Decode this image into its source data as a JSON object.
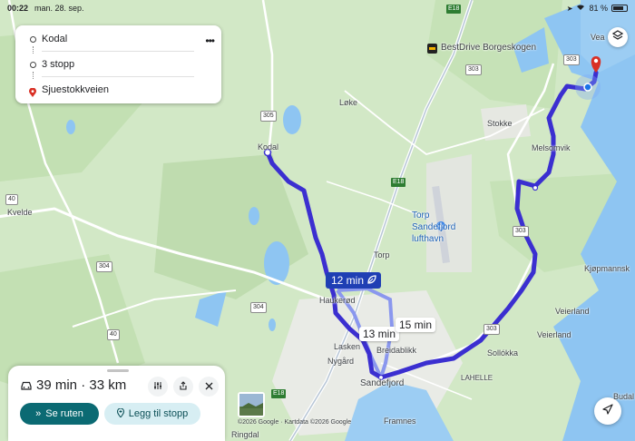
{
  "status_bar": {
    "time": "00:22",
    "date": "man. 28. sep.",
    "battery": "81 %",
    "battery_level": 0.81
  },
  "route_card": {
    "stops": [
      {
        "label": "Kodal",
        "icon": "origin-circle-icon"
      },
      {
        "label": "3 stopp",
        "icon": "waypoint-circle-icon"
      },
      {
        "label": "Sjuestokkveien",
        "icon": "destination-pin-icon"
      }
    ],
    "more_icon": "more-horizontal-icon"
  },
  "route_bubbles": {
    "main": "12 min",
    "alt1": "13 min",
    "alt2": "15 min"
  },
  "bottom_sheet": {
    "summary": "39 min · 33 km",
    "primary_button": "Se ruten",
    "secondary_button": "Legg til stopp"
  },
  "map": {
    "places": {
      "bestdrive": "BestDrive Borgeskogen",
      "vea": "Vea",
      "loke": "Løke",
      "kodal": "Kodal",
      "stokke": "Stokke",
      "melsomvik": "Melsomvik",
      "kvelde": "Kvelde",
      "torp_airport": "Torp\nSandefjord\nlufthavn",
      "torp": "Torp",
      "haukerod": "Haukerød",
      "lasken": "Lasken",
      "breidablikk": "Breidablikk",
      "nygard": "Nygård",
      "sandefjord": "Sandefjord",
      "sollokka": "Sollókka",
      "lahelle": "LAHELLE",
      "verland": "Veierland",
      "kjopmannskjar": "Kjøpmannsk",
      "framnes": "Framnes",
      "ringdal": "Ringdal",
      "budal": "Budal"
    },
    "road_numbers": {
      "r303a": "303",
      "r303b": "303",
      "r303c": "303",
      "r305": "305",
      "r304a": "304",
      "r304b": "304",
      "r40a": "40",
      "r40b": "40",
      "e18a": "E18",
      "e18b": "E18",
      "e18c": "E18"
    },
    "copyright": "©2026 Google · Kartdata ©2026 Google"
  },
  "colors": {
    "route": "#3b2fd0",
    "route_alt": "#7c8cf0",
    "water": "#8ec5f2",
    "land": "#d4e9c8",
    "primary_button": "#0b6a73",
    "secondary_button": "#d7eef3"
  }
}
